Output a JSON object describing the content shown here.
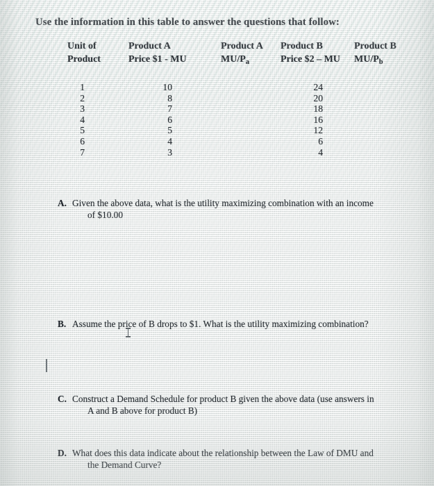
{
  "document": {
    "intro": "Use the information in this table to answer the questions that follow:"
  },
  "table": {
    "columns": [
      {
        "line1": "Unit of",
        "line2": "Product"
      },
      {
        "line1": "Product A",
        "line2": "Price $1 - MU"
      },
      {
        "line1": "Product A",
        "line2_pre": "MU/P",
        "line2_sub": "a"
      },
      {
        "line1": "Product B",
        "line2": "Price $2 – MU"
      },
      {
        "line1": "Product B",
        "line2_pre": "MU/P",
        "line2_sub": "b"
      }
    ],
    "unit_of_product": [
      "1",
      "2",
      "3",
      "4",
      "5",
      "6",
      "7"
    ],
    "product_a_mu": [
      "10",
      "8",
      "7",
      "6",
      "5",
      "4",
      "3"
    ],
    "product_a_mu_per_pa": [
      "",
      "",
      "",
      "",
      "",
      "",
      ""
    ],
    "product_b_mu": [
      "24",
      "20",
      "18",
      "16",
      "12",
      "6",
      "4"
    ],
    "product_b_mu_per_pb": [
      "",
      "",
      "",
      "",
      "",
      "",
      ""
    ]
  },
  "questions": [
    {
      "letter": "A.",
      "line1": "Given the above data, what is the utility maximizing combination with an income",
      "line2": "of $10.00"
    },
    {
      "letter": "B.",
      "line1": "Assume the price of B drops to $1.  What is the utility maximizing combination?",
      "line2": ""
    },
    {
      "letter": "C.",
      "line1": "Construct a Demand Schedule for product B given the above data (use answers in",
      "line2": "A and B above for product B)"
    },
    {
      "letter": "D.",
      "line1": "What does this data indicate about the relationship between the Law of DMU and",
      "line2": "the Demand Curve?"
    }
  ],
  "cursors": {
    "mouse_ibeam": "ibeam-cursor",
    "text_caret": "text-caret"
  },
  "colors": {
    "paper": "#e9ecea",
    "ink": "#20262c",
    "moire_tint": "#adcac4"
  }
}
